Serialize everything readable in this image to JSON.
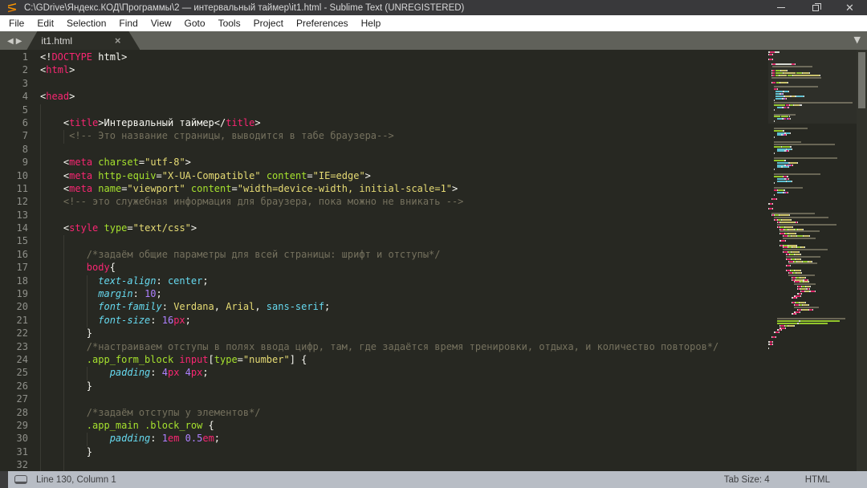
{
  "window": {
    "title": "C:\\GDrive\\Яндекс.КОД\\Программы\\2 — интервальный таймер\\it1.html - Sublime Text (UNREGISTERED)"
  },
  "menu": {
    "items": [
      "File",
      "Edit",
      "Selection",
      "Find",
      "View",
      "Goto",
      "Tools",
      "Project",
      "Preferences",
      "Help"
    ]
  },
  "tabbar": {
    "tab_label": "it1.html",
    "close_glyph": "×",
    "left_arrow": "◀",
    "right_arrow": "▶",
    "overflow_glyph": "▼"
  },
  "colors": {
    "background": "#272822",
    "tag_pink": "#f92672",
    "attr_green": "#a6e22e",
    "string_yellow": "#e6db74",
    "css_cyan": "#66d9ef",
    "number_purple": "#ae81ff",
    "comment_gray": "#75715e",
    "fg_white": "#f8f8f2",
    "statusbar": "#b8bdc5"
  },
  "editor": {
    "lines": [
      {
        "n": "1",
        "indent": 0,
        "guides": [],
        "t": [
          [
            "p",
            "<!"
          ],
          [
            "t",
            "DOCTYPE"
          ],
          [
            "p",
            " html"
          ],
          [
            "p",
            ">"
          ]
        ]
      },
      {
        "n": "2",
        "indent": 0,
        "guides": [],
        "t": [
          [
            "p",
            "<"
          ],
          [
            "t",
            "html"
          ],
          [
            "p",
            ">"
          ]
        ]
      },
      {
        "n": "3",
        "indent": 0,
        "guides": [],
        "t": []
      },
      {
        "n": "4",
        "indent": 0,
        "guides": [],
        "t": [
          [
            "p",
            "<"
          ],
          [
            "t",
            "head"
          ],
          [
            "p",
            ">"
          ]
        ]
      },
      {
        "n": "5",
        "indent": 0,
        "guides": [
          0
        ],
        "t": []
      },
      {
        "n": "6",
        "indent": 4,
        "guides": [
          0
        ],
        "t": [
          [
            "p",
            "<"
          ],
          [
            "t",
            "title"
          ],
          [
            "p",
            ">"
          ],
          [
            "p",
            "Интервальный таймер"
          ],
          [
            "p",
            "</"
          ],
          [
            "t",
            "title"
          ],
          [
            "p",
            ">"
          ]
        ]
      },
      {
        "n": "7",
        "indent": 5,
        "guides": [
          0,
          4
        ],
        "t": [
          [
            "c",
            "<!-- Это название страницы, выводится в табе браузера-->"
          ]
        ]
      },
      {
        "n": "8",
        "indent": 0,
        "guides": [
          0
        ],
        "t": []
      },
      {
        "n": "9",
        "indent": 4,
        "guides": [
          0
        ],
        "t": [
          [
            "p",
            "<"
          ],
          [
            "t",
            "meta"
          ],
          [
            "p",
            " "
          ],
          [
            "g",
            "charset"
          ],
          [
            "p",
            "="
          ],
          [
            "y",
            "\"utf-8\""
          ],
          [
            "p",
            ">"
          ]
        ]
      },
      {
        "n": "10",
        "indent": 4,
        "guides": [
          0
        ],
        "t": [
          [
            "p",
            "<"
          ],
          [
            "t",
            "meta"
          ],
          [
            "p",
            " "
          ],
          [
            "g",
            "http-equiv"
          ],
          [
            "p",
            "="
          ],
          [
            "y",
            "\"X-UA-Compatible\""
          ],
          [
            "p",
            " "
          ],
          [
            "g",
            "content"
          ],
          [
            "p",
            "="
          ],
          [
            "y",
            "\"IE=edge\""
          ],
          [
            "p",
            ">"
          ]
        ]
      },
      {
        "n": "11",
        "indent": 4,
        "guides": [
          0
        ],
        "t": [
          [
            "p",
            "<"
          ],
          [
            "t",
            "meta"
          ],
          [
            "p",
            " "
          ],
          [
            "g",
            "name"
          ],
          [
            "p",
            "="
          ],
          [
            "y",
            "\"viewport\""
          ],
          [
            "p",
            " "
          ],
          [
            "g",
            "content"
          ],
          [
            "p",
            "="
          ],
          [
            "y",
            "\"width=device-width, initial-scale=1\""
          ],
          [
            "p",
            ">"
          ]
        ]
      },
      {
        "n": "12",
        "indent": 4,
        "guides": [
          0
        ],
        "t": [
          [
            "c",
            "<!-- это служебная информация для браузера, пока можно не вникать -->"
          ]
        ]
      },
      {
        "n": "13",
        "indent": 0,
        "guides": [
          0
        ],
        "t": []
      },
      {
        "n": "14",
        "indent": 4,
        "guides": [
          0
        ],
        "t": [
          [
            "p",
            "<"
          ],
          [
            "t",
            "style"
          ],
          [
            "p",
            " "
          ],
          [
            "g",
            "type"
          ],
          [
            "p",
            "="
          ],
          [
            "y",
            "\"text/css\""
          ],
          [
            "p",
            ">"
          ]
        ]
      },
      {
        "n": "15",
        "indent": 0,
        "guides": [
          0,
          4
        ],
        "t": []
      },
      {
        "n": "16",
        "indent": 8,
        "guides": [
          0,
          4
        ],
        "t": [
          [
            "c",
            "/*задаём общие параметры для всей страницы: шрифт и отступы*/"
          ]
        ]
      },
      {
        "n": "17",
        "indent": 8,
        "guides": [
          0,
          4
        ],
        "t": [
          [
            "t",
            "body"
          ],
          [
            "p",
            "{"
          ]
        ]
      },
      {
        "n": "18",
        "indent": 10,
        "guides": [
          0,
          4,
          8
        ],
        "t": [
          [
            "k",
            "text-align"
          ],
          [
            "p",
            ": "
          ],
          [
            "v",
            "center"
          ],
          [
            "p",
            ";"
          ]
        ]
      },
      {
        "n": "19",
        "indent": 10,
        "guides": [
          0,
          4,
          8
        ],
        "t": [
          [
            "k",
            "margin"
          ],
          [
            "p",
            ": "
          ],
          [
            "m",
            "10"
          ],
          [
            "p",
            ";"
          ]
        ]
      },
      {
        "n": "20",
        "indent": 10,
        "guides": [
          0,
          4,
          8
        ],
        "t": [
          [
            "k",
            "font-family"
          ],
          [
            "p",
            ": "
          ],
          [
            "y",
            "Verdana"
          ],
          [
            "p",
            ", "
          ],
          [
            "y",
            "Arial"
          ],
          [
            "p",
            ", "
          ],
          [
            "v",
            "sans-serif"
          ],
          [
            "p",
            ";"
          ]
        ]
      },
      {
        "n": "21",
        "indent": 10,
        "guides": [
          0,
          4,
          8
        ],
        "t": [
          [
            "k",
            "font-size"
          ],
          [
            "p",
            ": "
          ],
          [
            "m",
            "16"
          ],
          [
            "t",
            "px"
          ],
          [
            "p",
            ";"
          ]
        ]
      },
      {
        "n": "22",
        "indent": 8,
        "guides": [
          0,
          4
        ],
        "t": [
          [
            "p",
            "}"
          ]
        ]
      },
      {
        "n": "23",
        "indent": 8,
        "guides": [
          0,
          4
        ],
        "t": [
          [
            "c",
            "/*настраиваем отступы в полях ввода цифр, там, где задаётся время тренировки, отдыха, и количество повторов*/"
          ]
        ]
      },
      {
        "n": "24",
        "indent": 8,
        "guides": [
          0,
          4
        ],
        "t": [
          [
            "g",
            ".app_form_block"
          ],
          [
            "p",
            " "
          ],
          [
            "t",
            "input"
          ],
          [
            "p",
            "["
          ],
          [
            "g",
            "type"
          ],
          [
            "p",
            "="
          ],
          [
            "y",
            "\"number\""
          ],
          [
            "p",
            "] {"
          ]
        ]
      },
      {
        "n": "25",
        "indent": 12,
        "guides": [
          0,
          4,
          8
        ],
        "t": [
          [
            "k",
            "padding"
          ],
          [
            "p",
            ": "
          ],
          [
            "m",
            "4"
          ],
          [
            "t",
            "px"
          ],
          [
            "p",
            " "
          ],
          [
            "m",
            "4"
          ],
          [
            "t",
            "px"
          ],
          [
            "p",
            ";"
          ]
        ]
      },
      {
        "n": "26",
        "indent": 8,
        "guides": [
          0,
          4
        ],
        "t": [
          [
            "p",
            "}"
          ]
        ]
      },
      {
        "n": "27",
        "indent": 0,
        "guides": [
          0,
          4
        ],
        "t": []
      },
      {
        "n": "28",
        "indent": 8,
        "guides": [
          0,
          4
        ],
        "t": [
          [
            "c",
            "/*задаём отступы у элементов*/"
          ]
        ]
      },
      {
        "n": "29",
        "indent": 8,
        "guides": [
          0,
          4
        ],
        "t": [
          [
            "g",
            ".app_main"
          ],
          [
            "p",
            " "
          ],
          [
            "g",
            ".block_row"
          ],
          [
            "p",
            " "
          ],
          [
            "p",
            "{"
          ]
        ]
      },
      {
        "n": "30",
        "indent": 12,
        "guides": [
          0,
          4,
          8
        ],
        "t": [
          [
            "k",
            "padding"
          ],
          [
            "p",
            ": "
          ],
          [
            "m",
            "1"
          ],
          [
            "t",
            "em"
          ],
          [
            "p",
            " "
          ],
          [
            "m",
            "0.5"
          ],
          [
            "t",
            "em"
          ],
          [
            "p",
            ";"
          ]
        ]
      },
      {
        "n": "31",
        "indent": 8,
        "guides": [
          0,
          4
        ],
        "t": [
          [
            "p",
            "}"
          ]
        ]
      },
      {
        "n": "32",
        "indent": 0,
        "guides": [
          0,
          4
        ],
        "t": []
      }
    ]
  },
  "minimap": {
    "extra_rows": [
      "",
      "8|c46",
      "8|g12,p2",
      "12|b10,p2,v6,p1",
      "12|b6,p2,m2,t2,p1",
      "8|p1",
      "",
      "8|c38",
      "8|c84",
      "8|g10,w1,g11,p2",
      "12|b12,p2,v6,p1",
      "12|b10,p2,m2,t2,p1",
      "8|p1",
      "",
      "8|c88",
      "8|g14,p2",
      "12|b16,p2,y10,p1",
      "12|b10,p2,m1,t2,w1,m3,t2,p1",
      "12|b6,p2,v8,p1",
      "8|p1",
      "",
      "8|c64",
      "8|g12,w1,t5,p2",
      "12|b10,p2,m2,t2,p1",
      "12|b12,p2,v6,p1",
      "8|p1",
      "",
      "8|c40",
      "8|t4,p1,g8,p2",
      "12|b8,p2,m3,t2,p1",
      "8|p1",
      "",
      "4|p2,t5,p1",
      "",
      "0|p2,t4,p1",
      "",
      "0|p1,t4,p1",
      "",
      "4|c60",
      "4|p1,t3,w1,g5,p1,y14,p1",
      "8|c75",
      "8|p1,t3,w1,g5,p1,y12,p1",
      "12|p1,t2,p1,y20,p2,t2,p1",
      "12|c82",
      "12|p1,t3,w1,g5,p1,y10,p1",
      "16|p1,t4,w1,g4,p1,y8,p1,g4,p1,y6,p1",
      "16|c55",
      "16|p1,t5,w1,g4,p1,y9,p1",
      "20|p1,t5,w1,g4,p1,y7,p1,g7,p1,y8,p1",
      "20|c45",
      "16|p2,t5,p1",
      "",
      "16|p1,t3,w1,g5,p1,y12,p1",
      "20|p1,t6,w1,g4,p1,y6,p1,g4,p1,y5,p1",
      "20|c62",
      "20|p1,t5,w1,g4,p1,y10,p1",
      "24|p1,t4,w1,g5,p1,y8,p1",
      "24|c48",
      "24|p1,t6,w1,g4,p1,y7,p1",
      "28|p1,t5,w1,g4,p1,y6,p1,g7,p1,y5,p1",
      "28|c40",
      "24|p2,t4,p1",
      "",
      "24|p1,t5,w1,g4,p1,y8,p1",
      "28|p1,t4,w1,g4,p1,y6,p1",
      "28|c36",
      "32|p1,t5,w1,g4,p1,y7,p1",
      "32|p1,t4,p1,y10,p2,t4,p1",
      "36|p1,t6,w1,g4,p1,y6,p1",
      "36|c30",
      "40|p1,t4,w1,g5,p1,y6,p1",
      "40|p1,t2,p1,y8,p2,t2,p1",
      "44|p1,t5,p1,y6,p2,t5,p1",
      "40|p2,t4,p1",
      "36|p2,t6,p1",
      "32|p2,t5,p1",
      "",
      "32|p1,t4,w1,g4,p1,y8,p1",
      "36|p1,t5,w1,g4,p1,y7,p1",
      "36|c34",
      "40|p1,t4,p1,y9,p2,t4,p1",
      "36|p2,t5,p1",
      "32|p2,t4,p1",
      "",
      "12|c95",
      "12|g30,w2,g55",
      "12|g28,w2,g40",
      "16|p1,t5,w1,g4,p1,y7,p1",
      "16|p2,t5,p1",
      "12|p2,t4,p1",
      "8|p2,t4,p1",
      "",
      "4|p2,t4,p1",
      "",
      "0|p2,t4,p1",
      "0|p2,t4,p1",
      "",
      "0|p1"
    ]
  },
  "statusbar": {
    "line_col": "Line 130, Column 1",
    "tab_size": "Tab Size: 4",
    "syntax": "HTML"
  }
}
